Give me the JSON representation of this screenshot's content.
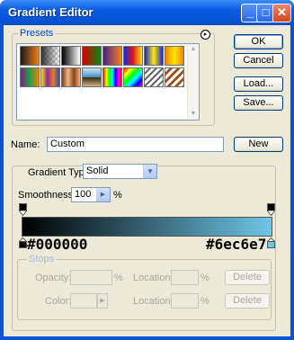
{
  "window": {
    "title": "Gradient Editor",
    "controls": {
      "minimize": "_",
      "maximize": "□",
      "close": "✕"
    }
  },
  "presets": {
    "legend": "Presets",
    "menu_icon": "▸",
    "swatches": [
      {
        "name": "foreground-to-background",
        "css": "linear-gradient(to right, #1b1b1b, #f07b19)"
      },
      {
        "name": "foreground-to-transparent",
        "css": "linear-gradient(to right, #303030, rgba(0,0,0,0)), repeating-conic-gradient(#ccc 0 25%, #fff 0 50%) 0 0 / 6px 6px"
      },
      {
        "name": "black-white",
        "css": "linear-gradient(to right, #000000, #ffffff)"
      },
      {
        "name": "red-green",
        "css": "linear-gradient(to right, #d70000, #008a16)"
      },
      {
        "name": "violet-orange",
        "css": "linear-gradient(to right, #4b1d8a, #f08516)"
      },
      {
        "name": "blue-red-yellow",
        "css": "linear-gradient(to right, #1428cf, #e2141d, #ffe800)"
      },
      {
        "name": "blue-yellow-blue",
        "css": "linear-gradient(to right, #1428cf, #ffeb00, #1428cf)"
      },
      {
        "name": "orange-yellow-orange",
        "css": "linear-gradient(to right, #f08000, #ffe800, #f08000)"
      },
      {
        "name": "violet-green-orange",
        "css": "linear-gradient(to right, #7a1b99, #20a339, #f07e15)"
      },
      {
        "name": "yellow-violet-orange-blue",
        "css": "linear-gradient(to right, #f6e018, #8d2d9c, #ef7c1c, #1c4fd1)"
      },
      {
        "name": "copper",
        "css": "linear-gradient(to right, #7a3a14, #f6b784, #8a4419, #f2b48a)"
      },
      {
        "name": "chrome",
        "css": "linear-gradient(to bottom, #cde5f9, #4a90c8 48%, #3a2a12 52%, #d2b68c)"
      },
      {
        "name": "spectrum",
        "css": "linear-gradient(to right, #ff0000, #ffff00, #00ff00, #00ffff, #0000ff, #ff00ff, #ff0000)"
      },
      {
        "name": "transparent-rainbow",
        "css": "linear-gradient(135deg, #ff0000, #ffff00, #00ff00, #00ffff, #0000ff, #ff00ff)"
      },
      {
        "name": "transparent-stripes",
        "css": "repeating-linear-gradient(135deg, #fff 0 3px, #666 3px 5px)"
      },
      {
        "name": "stripes",
        "css": "repeating-linear-gradient(135deg, #ffffff 0 3px, #a04b1a 3px 6px)"
      }
    ]
  },
  "buttons": {
    "ok": "OK",
    "cancel": "Cancel",
    "load": "Load...",
    "save": "Save...",
    "new": "New"
  },
  "name_field": {
    "label": "Name:",
    "value": "Custom"
  },
  "gradient_type": {
    "label": "Gradient Type:",
    "value": "Solid"
  },
  "smoothness": {
    "label": "Smoothness:",
    "value": "100",
    "unit": "%"
  },
  "gradient": {
    "start_color": "#000000",
    "end_color": "#6ec6e7",
    "start_label": "#000000",
    "end_label": "#6ec6e7"
  },
  "stops": {
    "legend": "Stops",
    "opacity_label": "Opacity:",
    "opacity_unit": "%",
    "color_label": "Color:",
    "location_label": "Location:",
    "location_unit": "%",
    "delete_label": "Delete"
  }
}
